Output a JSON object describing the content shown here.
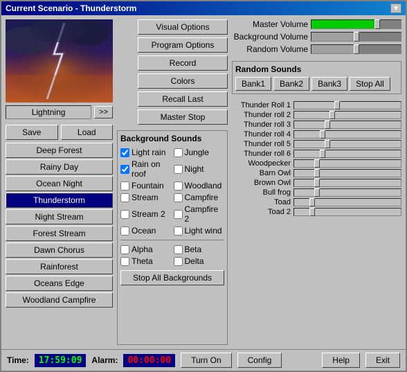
{
  "window": {
    "title": "Current Scenario - Thunderstorm"
  },
  "preview": {
    "label": "Lightning",
    "arrow": ">>"
  },
  "left": {
    "save": "Save",
    "load": "Load",
    "scenarios": [
      {
        "name": "Deep Forest",
        "active": false
      },
      {
        "name": "Rainy Day",
        "active": false
      },
      {
        "name": "Ocean Night",
        "active": false
      },
      {
        "name": "Thunderstorm",
        "active": true
      },
      {
        "name": "Night Stream",
        "active": false
      },
      {
        "name": "Forest Stream",
        "active": false
      },
      {
        "name": "Dawn Chorus",
        "active": false
      },
      {
        "name": "Rainforest",
        "active": false
      },
      {
        "name": "Oceans Edge",
        "active": false
      },
      {
        "name": "Woodland Campfire",
        "active": false
      }
    ]
  },
  "actions": {
    "visual": "Visual Options",
    "program": "Program Options",
    "record": "Record",
    "colors": "Colors",
    "recall": "Recall Last",
    "master_stop": "Master Stop"
  },
  "bg_sounds": {
    "title": "Background Sounds",
    "sounds": [
      {
        "label": "Light rain",
        "checked": true
      },
      {
        "label": "Jungle",
        "checked": false
      },
      {
        "label": "Rain on roof",
        "checked": true
      },
      {
        "label": "Night",
        "checked": false
      },
      {
        "label": "Fountain",
        "checked": false
      },
      {
        "label": "Woodland",
        "checked": false
      },
      {
        "label": "Stream",
        "checked": false
      },
      {
        "label": "Campfire",
        "checked": false
      },
      {
        "label": "Stream 2",
        "checked": false
      },
      {
        "label": "Campfire 2",
        "checked": false
      },
      {
        "label": "Ocean",
        "checked": false
      },
      {
        "label": "Light wind",
        "checked": false
      }
    ],
    "greek": [
      {
        "label": "Alpha",
        "checked": false
      },
      {
        "label": "Beta",
        "checked": false
      },
      {
        "label": "Theta",
        "checked": false
      },
      {
        "label": "Delta",
        "checked": false
      }
    ],
    "stop_all": "Stop All Backgrounds"
  },
  "right": {
    "master_volume_label": "Master Volume",
    "bg_volume_label": "Background Volume",
    "random_volume_label": "Random Volume",
    "master_volume": 75,
    "bg_volume": 50,
    "random_volume": 50,
    "random_sounds": {
      "title": "Random Sounds",
      "bank1": "Bank1",
      "bank2": "Bank2",
      "bank3": "Bank3",
      "stop_all": "Stop All"
    },
    "sliders": [
      {
        "label": "Thunder Roll 1",
        "value": 40
      },
      {
        "label": "Thunder roll 2",
        "value": 35
      },
      {
        "label": "Thunder roll 3",
        "value": 30
      },
      {
        "label": "Thunder roll 4",
        "value": 25
      },
      {
        "label": "Thunder roll 5",
        "value": 30
      },
      {
        "label": "Thunder roll 6",
        "value": 25
      },
      {
        "label": "Woodpecker",
        "value": 20
      },
      {
        "label": "Barn Owl",
        "value": 20
      },
      {
        "label": "Brown Owl",
        "value": 20
      },
      {
        "label": "Bull frog",
        "value": 20
      },
      {
        "label": "Toad",
        "value": 15
      },
      {
        "label": "Toad 2",
        "value": 15
      }
    ]
  },
  "status": {
    "time_label": "Time:",
    "time": "17:59:09",
    "alarm_label": "Alarm:",
    "alarm": "00:00:00",
    "turn_on": "Turn On",
    "config": "Config",
    "help": "Help",
    "exit": "Exit"
  }
}
